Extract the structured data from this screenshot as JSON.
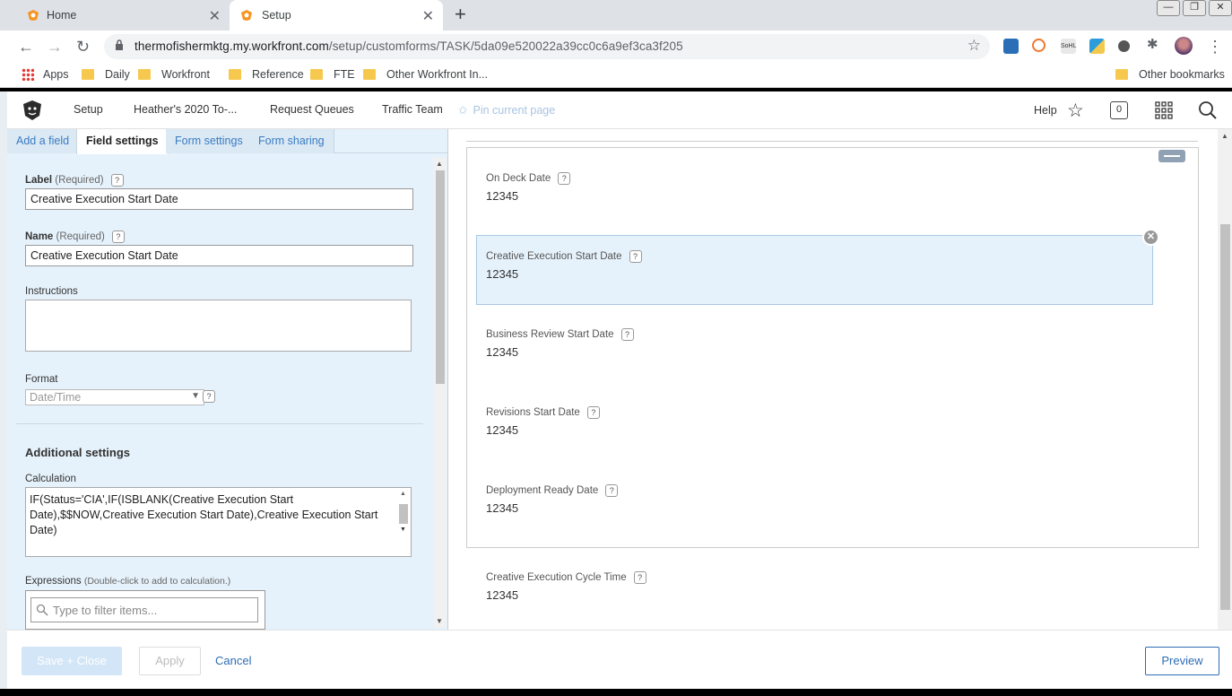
{
  "browser": {
    "tabs": [
      {
        "title": "Home",
        "active": false
      },
      {
        "title": "Setup",
        "active": true
      }
    ],
    "url_host": "thermofishermktg.my.workfront.com",
    "url_path": "/setup/customforms/TASK/5da09e520022a39cc0c6a9ef3ca3f205",
    "bookmarks": [
      "Apps",
      "Daily",
      "Workfront",
      "Reference",
      "FTE",
      "Other Workfront In...",
      "Other bookmarks"
    ]
  },
  "wfnav": {
    "items": [
      "Setup",
      "Heather's 2020 To-...",
      "Request Queues",
      "Traffic Team"
    ],
    "pin": "Pin current page",
    "help": "Help",
    "badge": "0"
  },
  "left": {
    "tabs": [
      "Add a field",
      "Field settings",
      "Form settings",
      "Form sharing"
    ],
    "label_title": "Label",
    "name_title": "Name",
    "required": "(Required)",
    "label_value": "Creative Execution Start Date",
    "name_value": "Creative Execution Start Date",
    "instructions_title": "Instructions",
    "format_title": "Format",
    "format_value": "Date/Time",
    "additional_settings": "Additional settings",
    "calculation_title": "Calculation",
    "calculation_value": "IF(Status='CIA',IF(ISBLANK(Creative Execution Start Date),$$NOW,Creative Execution Start Date),Creative Execution Start Date)",
    "expressions_title": "Expressions",
    "expressions_hint": "(Double-click to add to calculation.)",
    "filter_placeholder": "Type to filter items..."
  },
  "right": {
    "fields": [
      {
        "label": "On Deck Date",
        "value": "12345"
      },
      {
        "label": "Creative Execution Start Date",
        "value": "12345"
      },
      {
        "label": "Business Review Start Date",
        "value": "12345"
      },
      {
        "label": "Revisions Start Date",
        "value": "12345"
      },
      {
        "label": "Deployment Ready Date",
        "value": "12345"
      },
      {
        "label": "Creative Execution Cycle Time",
        "value": "12345"
      }
    ]
  },
  "footer": {
    "save": "Save + Close",
    "apply": "Apply",
    "cancel": "Cancel",
    "preview": "Preview"
  },
  "colors": {
    "accent": "#2d6db5",
    "panel_bg": "#e6f2fb"
  }
}
